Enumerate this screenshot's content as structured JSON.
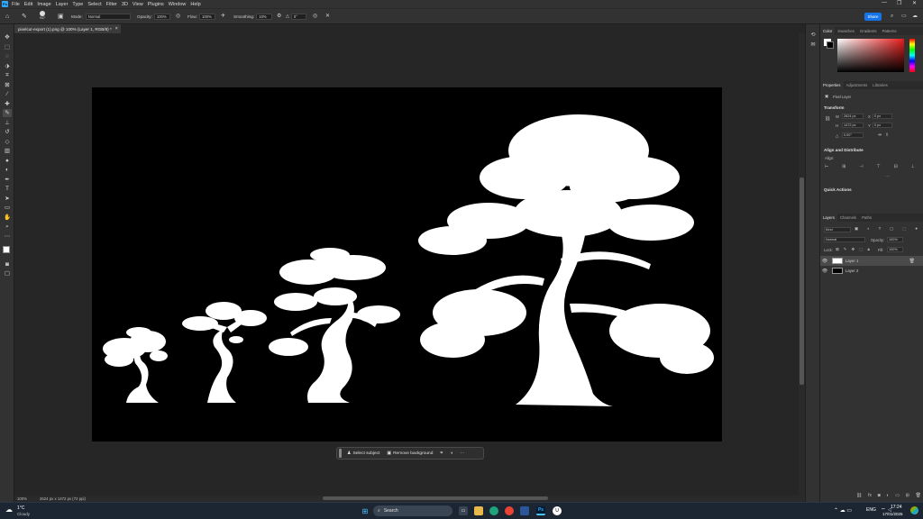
{
  "menu": {
    "app_icon": "Ps",
    "items": [
      "File",
      "Edit",
      "Image",
      "Layer",
      "Type",
      "Select",
      "Filter",
      "3D",
      "View",
      "Plugins",
      "Window",
      "Help"
    ],
    "window_controls": [
      "—",
      "❐",
      "✕"
    ]
  },
  "options": {
    "brush_size": "947",
    "mode_label": "Mode:",
    "mode_value": "Normal",
    "opacity_label": "Opacity:",
    "opacity_value": "100%",
    "flow_label": "Flow:",
    "flow_value": "100%",
    "smoothing_label": "Smoothing:",
    "smoothing_value": "10%",
    "angle_value": "0°",
    "share_label": "Share"
  },
  "document": {
    "tab_title": "pixelcut-export (1).png @ 100% (Layer 1, RGB/8) *",
    "zoom": "100%",
    "doc_info": "2624 px x 1472 px (72 ppi)"
  },
  "context_bar": {
    "select_subject": "Select subject",
    "remove_background": "Remove background"
  },
  "panels": {
    "color_tabs": [
      "Color",
      "Swatches",
      "Gradients",
      "Patterns"
    ],
    "properties_tabs": [
      "Properties",
      "Adjustments",
      "Libraries"
    ],
    "pixel_layer": "Pixel Layer",
    "transform_title": "Transform",
    "w_label": "W",
    "w_value": "2624 px",
    "h_label": "H",
    "h_value": "1472 px",
    "x_label": "X",
    "x_value": "0 px",
    "y_label": "Y",
    "y_value": "0 px",
    "angle_value": "0.00°",
    "align_title": "Align and Distribute",
    "align_sub": "Align:",
    "quick_title": "Quick Actions",
    "layers_tabs": [
      "Layers",
      "Channels",
      "Paths"
    ],
    "kind_value": "Kind",
    "blend_value": "Normal",
    "opacity_label": "Opacity:",
    "opacity_value": "100%",
    "lock_label": "Lock:",
    "fill_label": "Fill:",
    "fill_value": "100%",
    "layers": [
      {
        "name": "Layer 1",
        "selected": true
      },
      {
        "name": "Layer 2",
        "selected": false
      }
    ]
  },
  "taskbar": {
    "temperature": "1°C",
    "weather": "Cloudy",
    "search": "Search",
    "time": "17:24",
    "date": "17/01/2025",
    "lang": "ENG"
  },
  "colors": {
    "accent": "#1473e6",
    "ps_blue": "#31a8ff",
    "panel": "#323232",
    "canvas_bg": "#000000",
    "tree": "#ffffff"
  }
}
